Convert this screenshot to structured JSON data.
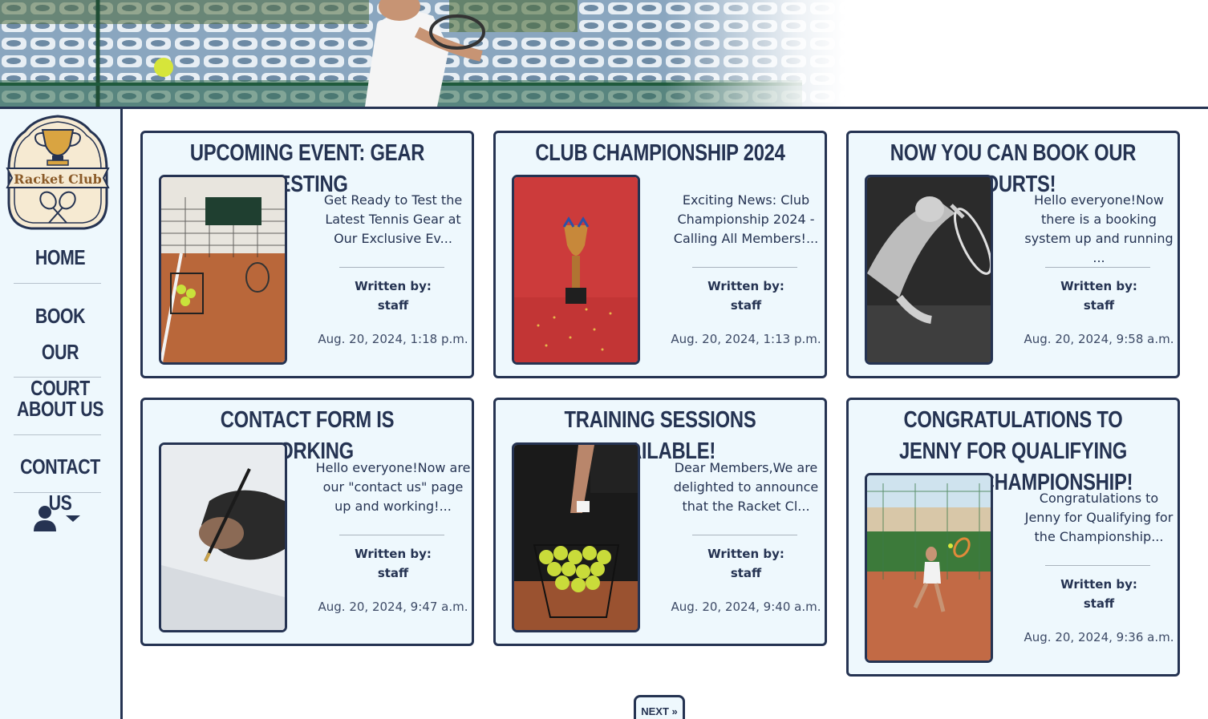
{
  "site": {
    "logo_text": "Racket Club"
  },
  "nav": {
    "home": "HOME",
    "book_court": "BOOK OUR COURT",
    "about": "ABOUT US",
    "contact": "CONTACT US"
  },
  "posts": [
    {
      "title": "Upcoming Event: Gear Testing",
      "excerpt": "Get Ready to Test the Latest Tennis Gear at Our Exclusive Ev...",
      "written_by_label": "Written by:",
      "author": "staff",
      "date": "Aug. 20, 2024, 1:18 p.m."
    },
    {
      "title": "Club Championship 2024",
      "excerpt": "Exciting News: Club Championship 2024 - Calling All Members!...",
      "written_by_label": "Written by:",
      "author": "staff",
      "date": "Aug. 20, 2024, 1:13 p.m."
    },
    {
      "title": "Now you can book our courts!",
      "excerpt": "Hello everyone!Now there is a booking system up and running ...",
      "written_by_label": "Written by:",
      "author": "staff",
      "date": "Aug. 20, 2024, 9:58 a.m."
    },
    {
      "title": "Contact form is working",
      "excerpt": "Hello everyone!Now are our \"contact us\" page up and working!...",
      "written_by_label": "Written by:",
      "author": "staff",
      "date": "Aug. 20, 2024, 9:47 a.m."
    },
    {
      "title": "Training Sessions Available!",
      "excerpt": "Dear Members,We are delighted to announce that the Racket Cl...",
      "written_by_label": "Written by:",
      "author": "staff",
      "date": "Aug. 20, 2024, 9:40 a.m."
    },
    {
      "title": "Congratulations to Jenny for Qualifying for the Championship!",
      "excerpt": "Congratulations to Jenny for Qualifying for the Championship...",
      "written_by_label": "Written by:",
      "author": "staff",
      "date": "Aug. 20, 2024, 9:36 a.m."
    }
  ],
  "pagination": {
    "next_label": "NEXT »"
  },
  "icons": {
    "user": "user-icon",
    "dropdown": "caret-down-icon"
  },
  "colors": {
    "navy": "#253352",
    "card_bg": "#eef8fd",
    "accent_gold": "#d9a441"
  }
}
